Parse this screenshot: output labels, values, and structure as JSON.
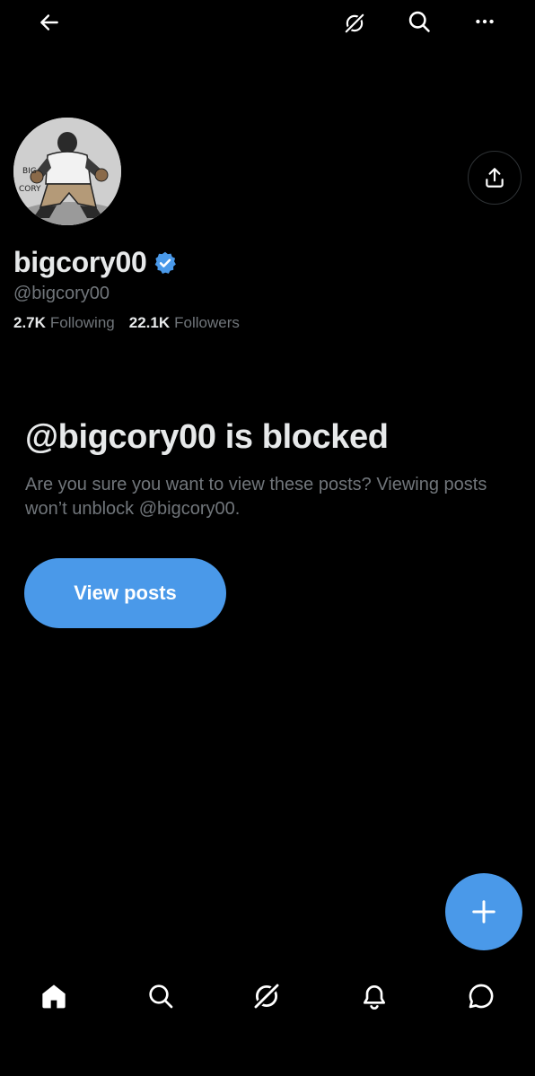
{
  "header": {
    "back_icon": "arrow-left-icon",
    "grok_icon": "grok-icon",
    "search_icon": "search-icon",
    "more_icon": "more-horizontal-icon"
  },
  "profile": {
    "display_name": "bigcory00",
    "handle": "@bigcory00",
    "verified": true,
    "following_count": "2.7K",
    "following_label": "Following",
    "followers_count": "22.1K",
    "followers_label": "Followers",
    "share_icon": "share-icon"
  },
  "blocked": {
    "title": "@bigcory00 is blocked",
    "description": "Are you sure you want to view these posts? Viewing posts won’t unblock @bigcory00.",
    "view_button_label": "View posts"
  },
  "fab": {
    "icon": "plus-icon"
  },
  "bottom_nav": {
    "items": [
      "home-icon",
      "search-icon",
      "grok-icon",
      "notifications-icon",
      "messages-icon"
    ]
  },
  "colors": {
    "background": "#000000",
    "accent": "#4a99e9",
    "text_primary": "#e7e9ea",
    "text_secondary": "#71767b"
  }
}
